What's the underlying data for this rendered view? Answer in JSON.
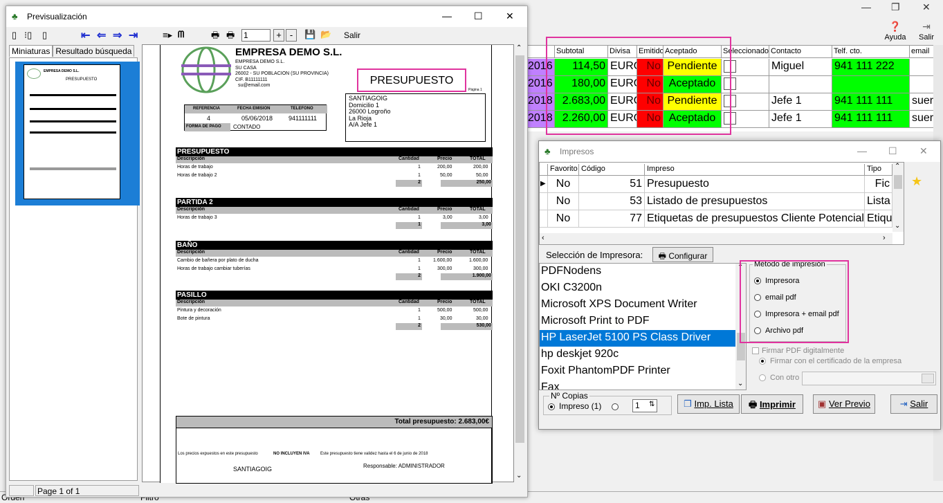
{
  "bg": {
    "help": "Ayuda",
    "exit": "Salir",
    "headers": [
      "Subtotal",
      "Divisa",
      "Emitido",
      "Aceptado",
      "Seleccionado",
      "Contacto",
      "Telf. cto.",
      "email"
    ],
    "rows": [
      {
        "year": "2016",
        "subtotal": "114,50",
        "divisa": "EURO",
        "emitido": "No",
        "aceptado": "Pendiente",
        "contacto": "Miguel",
        "telf": "941 111 222",
        "email": ""
      },
      {
        "year": "2016",
        "subtotal": "180,00",
        "divisa": "EURO",
        "emitido": "No",
        "aceptado": "Aceptado",
        "contacto": "",
        "telf": "",
        "email": ""
      },
      {
        "year": "2018",
        "subtotal": "2.683,00",
        "divisa": "EURO",
        "emitido": "No",
        "aceptado": "Pendiente",
        "contacto": "Jefe 1",
        "telf": "941 111 111",
        "email": "suer"
      },
      {
        "year": "2018",
        "subtotal": "2.260,00",
        "divisa": "EURO",
        "emitido": "No",
        "aceptado": "Aceptado",
        "contacto": "Jefe 1",
        "telf": "941 111 111",
        "email": "suer"
      }
    ],
    "status": {
      "orden": "Orden",
      "filtro": "Filtro",
      "otras": "Otras"
    }
  },
  "preview": {
    "title": "Previsualización",
    "page_input": "1",
    "exit": "Salir",
    "tab_thumbs": "Miniaturas",
    "tab_search": "Resultado búsqueda",
    "status": "Page 1 of 1",
    "doc": {
      "company": "EMPRESA DEMO S.L.",
      "company_lines": [
        "EMPRESA DEMO S.L.",
        "SU CASA",
        "26002 - SU POBLACION (SU PROVINCIA)",
        "CIF. B11111111",
        "su@email.com"
      ],
      "title": "PRESUPUESTO",
      "page": "Página 1",
      "ref_label": "REFERENCIA",
      "date_label": "FECHA EMISION",
      "phone_label": "TELEFONO",
      "ref": "4",
      "date": "05/06/2018",
      "phone": "941111111",
      "pay_label": "FORMA DE PAGO",
      "pay": "CONTADO",
      "client": [
        "SANTIAGOIG",
        "Domicilio 1",
        "26000 Logroño",
        "La Rioja",
        "A/A Jefe 1"
      ],
      "col_desc": "Descripción",
      "col_qty": "Cantidad",
      "col_price": "Precio",
      "col_total": "TOTAL",
      "sections": [
        {
          "name": "PRESUPUESTO",
          "rows": [
            {
              "d": "Horas de trabajo",
              "q": "1",
              "p": "200,00",
              "t": "200,00"
            },
            {
              "d": "Horas de trabajo 2",
              "q": "1",
              "p": "50,00",
              "t": "50,00"
            }
          ],
          "sumq": "2",
          "sumt": "250,00"
        },
        {
          "name": "PARTIDA 2",
          "rows": [
            {
              "d": "Horas de trabajo 3",
              "q": "1",
              "p": "3,00",
              "t": "3,00"
            }
          ],
          "sumq": "1",
          "sumt": "3,00"
        },
        {
          "name": "BAÑO",
          "rows": [
            {
              "d": "Cambio de bañera por plato de ducha",
              "q": "1",
              "p": "1.600,00",
              "t": "1.600,00"
            },
            {
              "d": "Horas de trabajo cambiar tuberías",
              "q": "1",
              "p": "300,00",
              "t": "300,00"
            }
          ],
          "sumq": "2",
          "sumt": "1.900,00"
        },
        {
          "name": "PASILLO",
          "rows": [
            {
              "d": "Pintura y decoración",
              "q": "1",
              "p": "500,00",
              "t": "500,00"
            },
            {
              "d": "Bote de pintura",
              "q": "1",
              "p": "30,00",
              "t": "30,00"
            }
          ],
          "sumq": "2",
          "sumt": "530,00"
        }
      ],
      "total_label": "Total presupuesto: 2.683,00€",
      "note_a": "Los precios expuestos en este presupuesto",
      "note_b": "NO INCLUYEN IVA",
      "note_c": "Este presupuesto tiene validez hasta el 6 de junio de 2018",
      "sign_client": "SANTIAGOIG",
      "sign_resp": "Responsable: ADMINISTRADOR"
    }
  },
  "impresos": {
    "title": "Impresos",
    "headers": [
      "Favorito",
      "Código",
      "Impreso",
      "Tipo"
    ],
    "rows": [
      {
        "fav": "No",
        "code": "51",
        "name": "Presupuesto",
        "type": "Fic"
      },
      {
        "fav": "No",
        "code": "53",
        "name": "Listado de presupuestos",
        "type": "Lista"
      },
      {
        "fav": "No",
        "code": "77",
        "name": "Etiquetas de presupuestos Cliente Potencial",
        "type": "Etique"
      }
    ],
    "printer_sel": "Selección de Impresora:",
    "configure": "Configurar",
    "printers": [
      "PDFNodens",
      "OKI C3200n",
      "Microsoft XPS Document Writer",
      "Microsoft Print to PDF",
      "HP LaserJet 5100 PS Class Driver",
      "hp deskjet 920c",
      "Foxit PhantomPDF Printer",
      "Fax"
    ],
    "method_label": "Método de impresión",
    "methods": [
      "Impresora",
      "email pdf",
      "Impresora + email pdf",
      "Archivo pdf"
    ],
    "sign_pdf": "Firmar PDF digitalmente",
    "sign_cert": "Firmar con el certificado de la empresa",
    "sign_other": "Con otro",
    "copies_label": "Nº Copias",
    "copies_opt": "Impreso (1)",
    "copies_val": "1",
    "btn_list": "Imp. Lista",
    "btn_print": "Imprimir",
    "btn_preview": "Ver Previo",
    "btn_exit": "Salir"
  }
}
